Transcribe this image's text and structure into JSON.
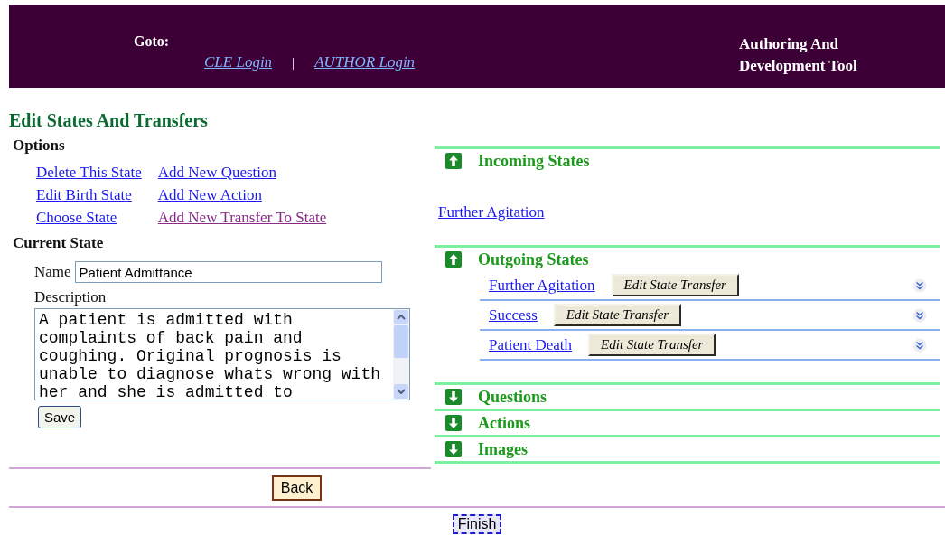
{
  "header": {
    "goto_label": "Goto:",
    "links": [
      {
        "label": "CLE Login"
      },
      {
        "label": "AUTHOR Login"
      }
    ],
    "separator": "|",
    "title": "Authoring And Development Tool"
  },
  "page_title": "Edit States And Transfers",
  "options": {
    "heading": "Options",
    "columns": [
      [
        {
          "label": "Delete This State",
          "visited": false
        },
        {
          "label": "Edit Birth State",
          "visited": false
        },
        {
          "label": "Choose State",
          "visited": false
        }
      ],
      [
        {
          "label": "Add New Question",
          "visited": false
        },
        {
          "label": "Add New Action",
          "visited": false
        },
        {
          "label": "Add New Transfer To State",
          "visited": true
        }
      ]
    ]
  },
  "current_state": {
    "heading": "Current State",
    "name_label": "Name",
    "name_value": "Patient Admittance",
    "description_label": "Description",
    "description_value": "A patient is admitted with complaints of back pain and coughing. Original prognosis is unable to diagnose whats wrong with her and she is admitted to",
    "save_button": "Save"
  },
  "sections": [
    {
      "title": "Incoming States",
      "expanded": true,
      "kind": "incoming",
      "items": [
        {
          "label": "Further Agitation"
        }
      ]
    },
    {
      "title": "Outgoing States",
      "expanded": true,
      "kind": "outgoing",
      "items": [
        {
          "label": "Further Agitation",
          "button": "Edit State Transfer"
        },
        {
          "label": "Success",
          "button": "Edit State Transfer"
        },
        {
          "label": "Patient Death",
          "button": "Edit State Transfer"
        }
      ]
    },
    {
      "title": "Questions",
      "expanded": false
    },
    {
      "title": "Actions",
      "expanded": false
    },
    {
      "title": "Images",
      "expanded": false
    }
  ],
  "back_button": "Back",
  "finish_button": "Finish"
}
